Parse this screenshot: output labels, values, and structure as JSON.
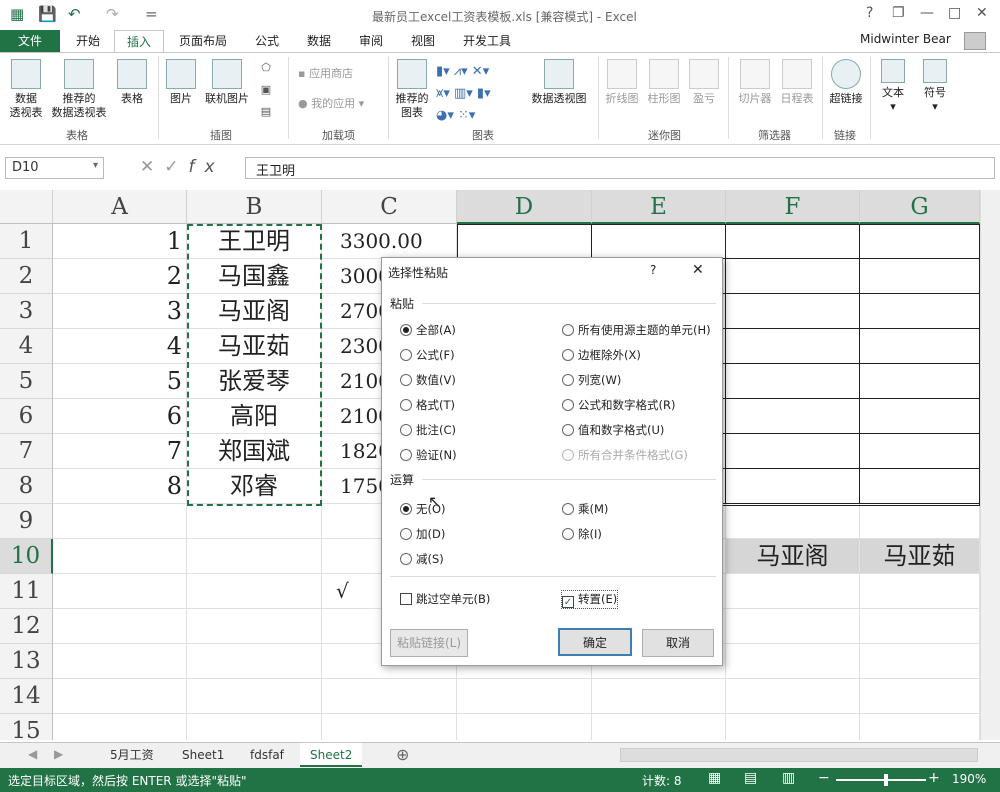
{
  "titlebar": {
    "title": "最新员工excel工资表模板.xls  [兼容模式] - Excel",
    "help": "?",
    "restore": "❐",
    "minimize": "—",
    "maximize": "□",
    "close": "✕",
    "qa_save": "💾",
    "qa_undo": "↶",
    "qa_redo": "↷",
    "qa_custom": "="
  },
  "tabs": {
    "file": "文件",
    "home": "开始",
    "insert": "插入",
    "layout": "页面布局",
    "formula": "公式",
    "data": "数据",
    "review": "审阅",
    "view": "视图",
    "dev": "开发工具",
    "user": "Midwinter Bear"
  },
  "ribbon": {
    "pivot": "数据透视表",
    "pivot2": "透视表",
    "rec_pivot": "推荐的",
    "rec_pivot2": "数据透视表",
    "table": "表格",
    "picture": "图片",
    "online_pic": "联机图片",
    "appstore": "应用商店",
    "myapps": "我的应用",
    "rec_chart": "推荐的",
    "rec_chart2": "图表",
    "pivot_chart": "数据透视图",
    "line": "折线图",
    "column": "柱形图",
    "winloss": "盈亏",
    "slicer": "切片器",
    "timeline": "日程表",
    "hyperlink": "超链接",
    "text": "文本",
    "symbol": "符号",
    "pivot_top": "数据",
    "g_tables": "表格",
    "g_illus": "插图",
    "g_addins": "加载项",
    "g_charts": "图表",
    "g_spark": "迷你图",
    "g_filter": "筛选器",
    "g_link": "链接"
  },
  "formula": {
    "namebox": "D10",
    "value": "王卫明",
    "fx": "fx"
  },
  "grid": {
    "cols": [
      "A",
      "B",
      "C",
      "D",
      "E",
      "F",
      "G"
    ],
    "rows": [
      "1",
      "2",
      "3",
      "4",
      "5",
      "6",
      "7",
      "8",
      "9",
      "10",
      "11",
      "12",
      "13",
      "14",
      "15"
    ],
    "a": [
      "1",
      "2",
      "3",
      "4",
      "5",
      "6",
      "7",
      "8"
    ],
    "b": [
      "王卫明",
      "马国鑫",
      "马亚阁",
      "马亚茹",
      "张爱琴",
      "高阳",
      "郑国斌",
      "邓睿"
    ],
    "c": [
      "3300.00",
      "3000",
      "2700",
      "2300",
      "2100",
      "2100",
      "1820",
      "1750"
    ],
    "r10f": "马亚阁",
    "r10g": "马亚茹",
    "check": "√"
  },
  "dialog": {
    "title": "选择性粘贴",
    "help": "?",
    "close": "✕",
    "paste_section": "粘贴",
    "op_section": "运算",
    "paste_opts": [
      "全部(A)",
      "公式(F)",
      "数值(V)",
      "格式(T)",
      "批注(C)",
      "验证(N)"
    ],
    "paste_opts2": [
      "所有使用源主题的单元(H)",
      "边框除外(X)",
      "列宽(W)",
      "公式和数字格式(R)",
      "值和数字格式(U)",
      "所有合并条件格式(G)"
    ],
    "op_opts": [
      "无(O)",
      "加(D)",
      "减(S)"
    ],
    "op_opts2": [
      "乘(M)",
      "除(I)"
    ],
    "skip_blanks": "跳过空单元(B)",
    "transpose": "转置(E)",
    "paste_link": "粘贴链接(L)",
    "ok": "确定",
    "cancel": "取消"
  },
  "sheets": [
    "5月工资",
    "Sheet1",
    "fdsfaf",
    "Sheet2"
  ],
  "status": {
    "msg": "选定目标区域，然后按 ENTER 或选择\"粘贴\"",
    "count": "计数: 8",
    "zoom": "190%"
  },
  "colors": {
    "accent": "#217346"
  }
}
